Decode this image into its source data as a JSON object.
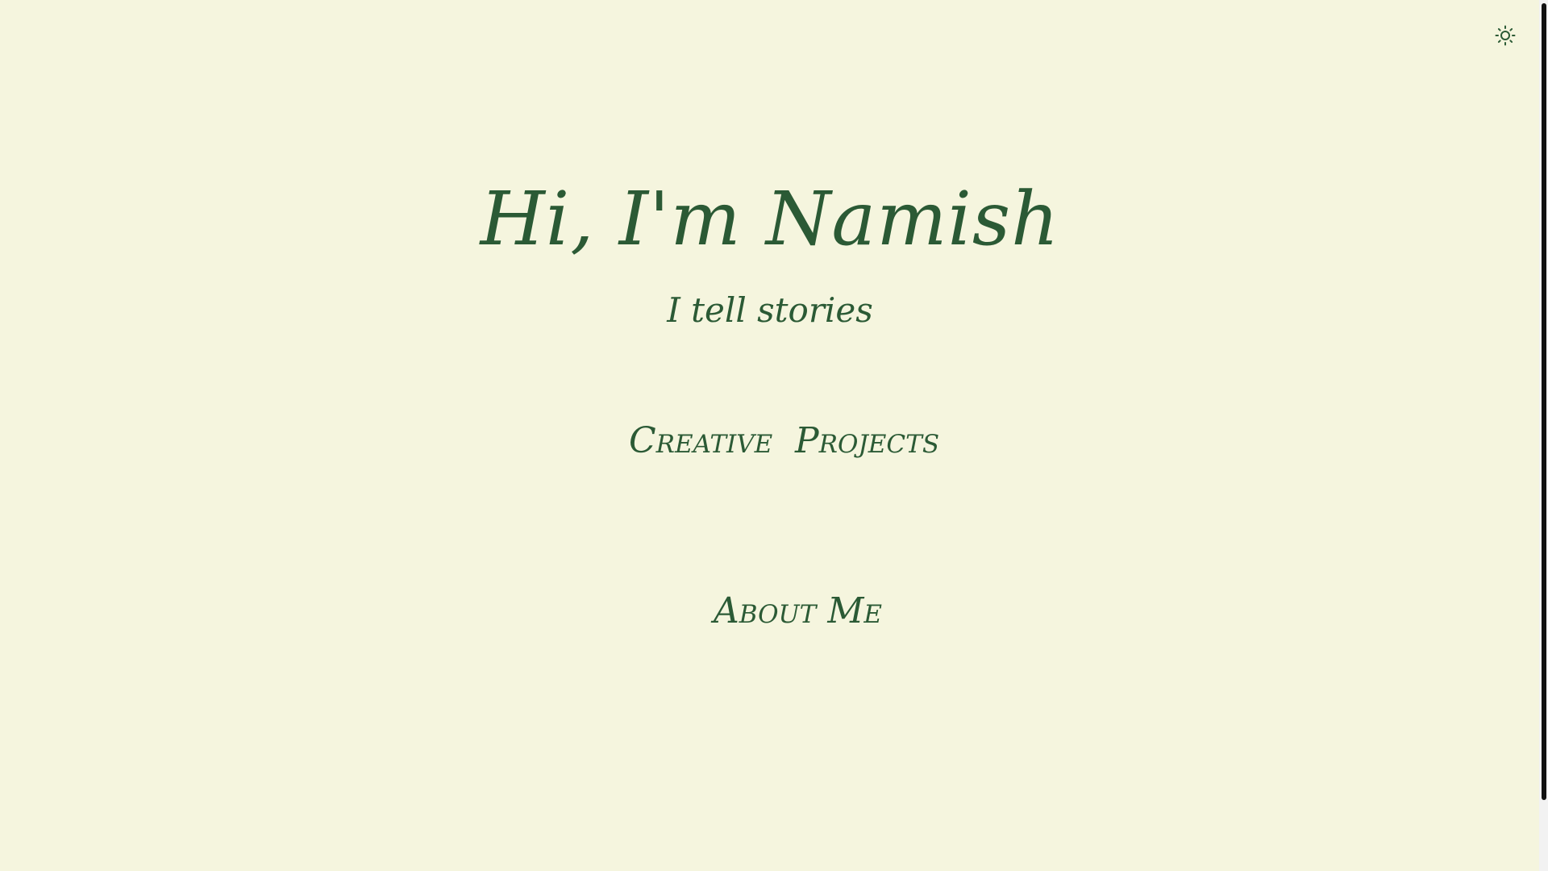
{
  "colors": {
    "background": "#f5f5de",
    "text": "#2b5a35",
    "scrollbar_thumb": "#111111"
  },
  "theme_toggle": {
    "icon": "sun-icon"
  },
  "hero": {
    "title": "Hi, I'm Namish",
    "subtitle": "I tell stories"
  },
  "nav": {
    "creative": "Creative",
    "projects": "Projects",
    "about": "About Me"
  }
}
